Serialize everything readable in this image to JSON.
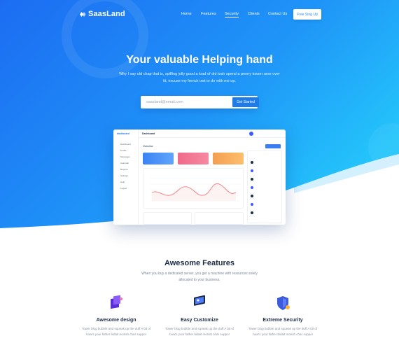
{
  "brand": {
    "name": "SaasLand"
  },
  "nav": {
    "items": [
      {
        "label": "Home"
      },
      {
        "label": "Features"
      },
      {
        "label": "Security"
      },
      {
        "label": "Clients"
      },
      {
        "label": "Contact Us"
      }
    ],
    "cta": "Free Sing Up"
  },
  "hero": {
    "title": "Your valuable Helping hand",
    "subtitle": "Why I say old chap that is, spiffing jolly good a load of old tosh spend a penny tosser arse over tit, excuse my french owt to do with me up.",
    "email_placeholder": "saasland@email.com",
    "button": "Get Started"
  },
  "dashboard": {
    "logo": "dashboard",
    "title": "Dashboard",
    "overview": "Overview",
    "sidebar": [
      "Dashboard",
      "Profile",
      "Messages",
      "Calendar",
      "Reports",
      "Settings",
      "Help",
      "Logout"
    ]
  },
  "features": {
    "title": "Awesome Features",
    "subtitle": "When you buy a dedicated server, you get a machine with resources solely allocated to your business.",
    "items": [
      {
        "title": "Awesome design",
        "desc": "Tower blog bubble and squeak up the duff A bit of how's your father bidait morish char suppo!"
      },
      {
        "title": "Easy Customize",
        "desc": "Tower blog bubble and squeak up the duff A bit of how's your father bidait morish char suppo!"
      },
      {
        "title": "Extreme Security",
        "desc": "Tower blog bubble and squeak up the duff A bit of how's your father bidait morish char suppo!"
      }
    ]
  },
  "colors": {
    "accent": "#1f7be8",
    "hero_start": "#1d6ff2",
    "hero_end": "#22c2fb"
  }
}
